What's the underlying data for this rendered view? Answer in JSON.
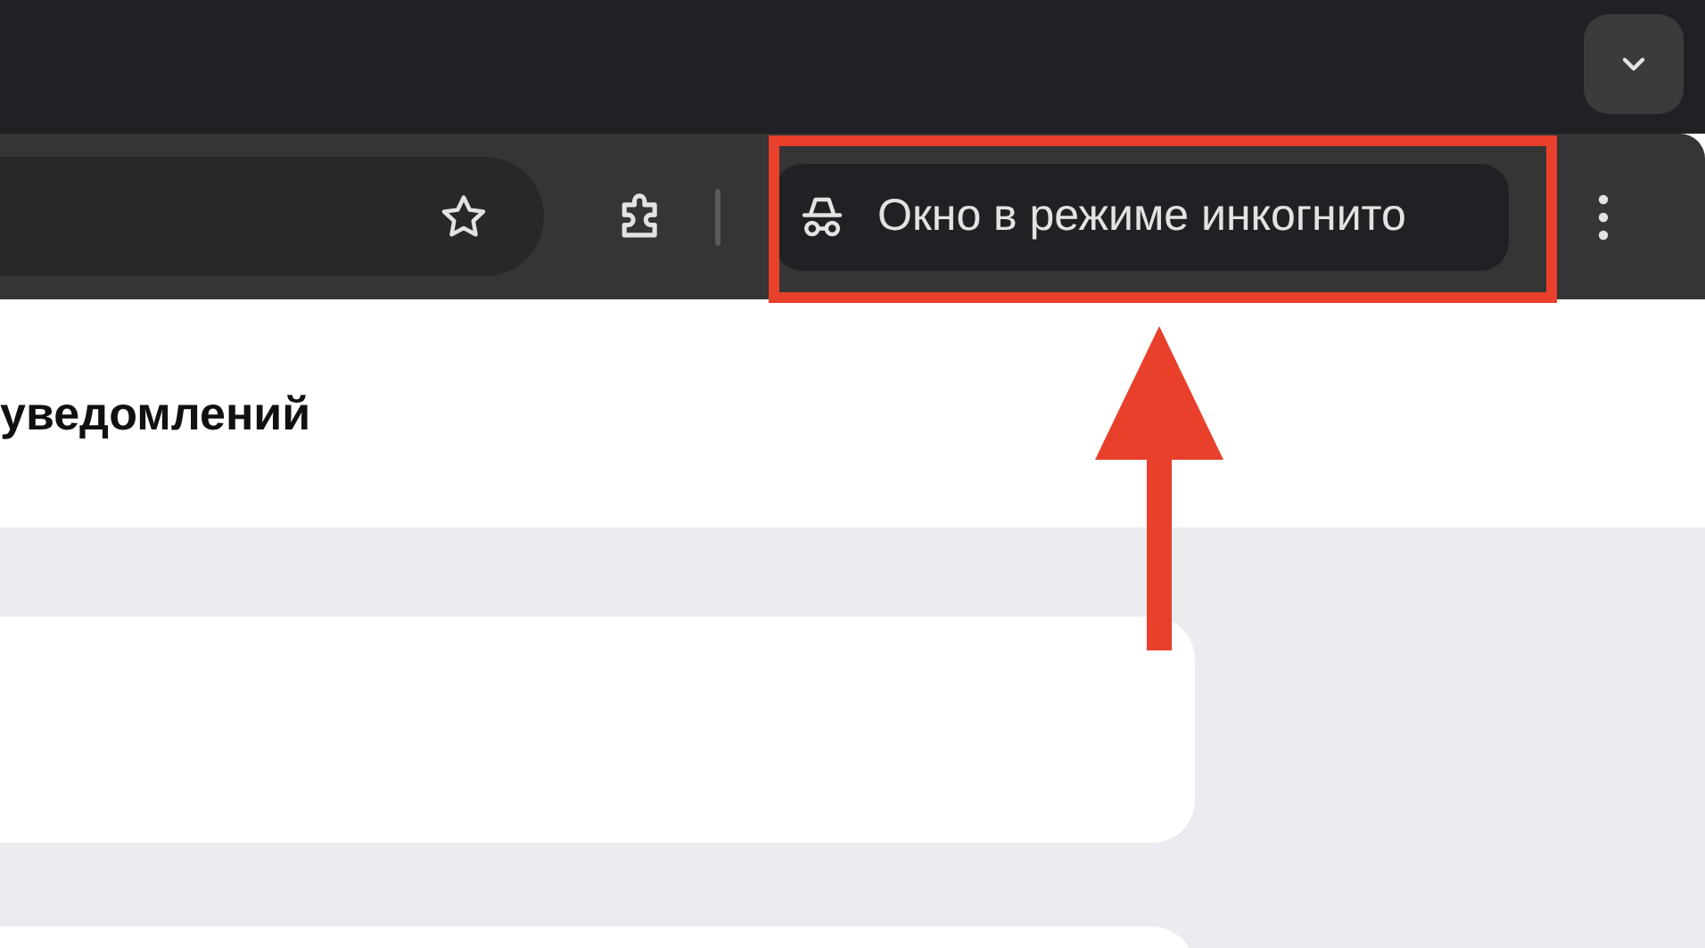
{
  "toolbar": {
    "incognito_label": "Окно в режиме инкогнито"
  },
  "page": {
    "heading": "уведомлений"
  }
}
